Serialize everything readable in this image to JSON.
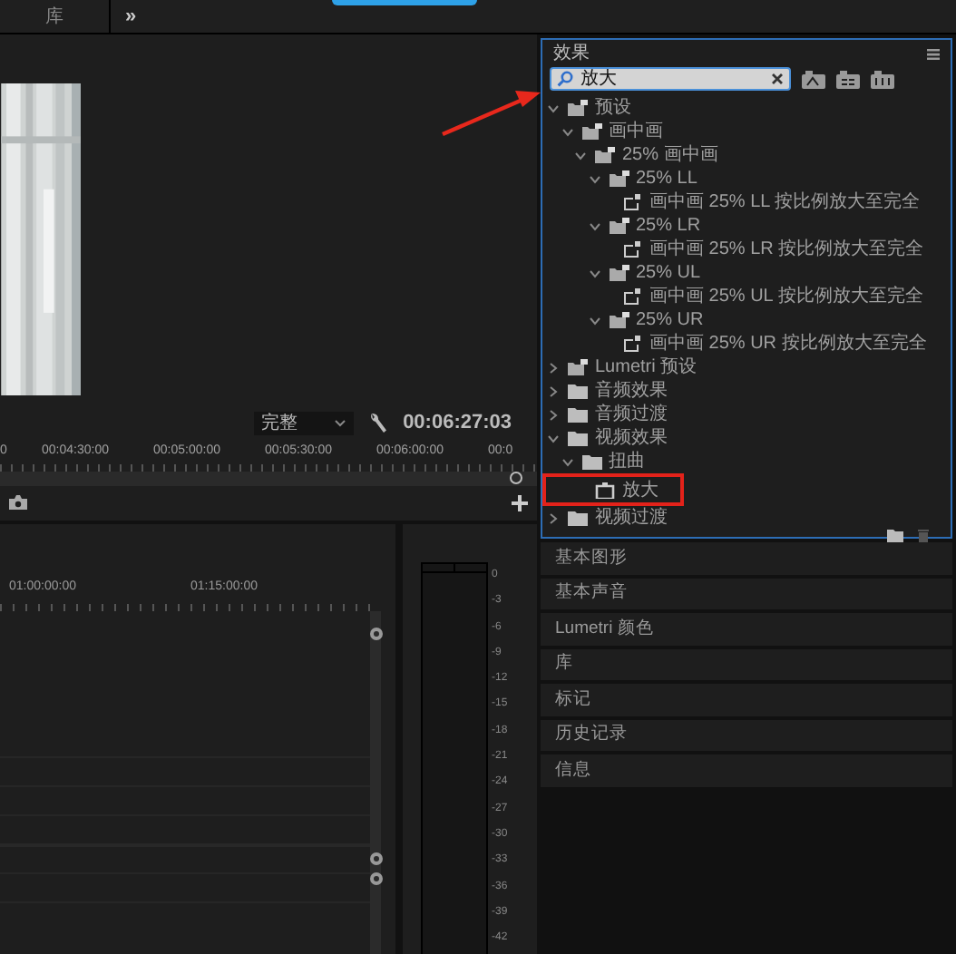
{
  "top_bar": {
    "tabs": [
      {
        "label": "库",
        "selected": false
      }
    ],
    "more": "»"
  },
  "monitor": {
    "quality": "完整",
    "timecode": "00:06:27:03",
    "ruler": [
      "0",
      "00:04:30:00",
      "00:05:00:00",
      "00:05:30:00",
      "00:06:00:00",
      "00:0"
    ]
  },
  "timeline": {
    "ruler": [
      "01:00:00:00",
      "01:15:00:00"
    ]
  },
  "meter": {
    "scale": [
      "0",
      "-3",
      "-6",
      "-9",
      "-12",
      "-15",
      "-18",
      "-21",
      "-24",
      "-27",
      "-30",
      "-33",
      "-36",
      "-39",
      "-42"
    ]
  },
  "effects_panel": {
    "title": "效果",
    "search": {
      "value": "放大"
    },
    "tree": [
      {
        "label": "预设",
        "kind": "bin",
        "expanded": true,
        "children": [
          {
            "label": "画中画",
            "kind": "bin",
            "expanded": true,
            "children": [
              {
                "label": "25% 画中画",
                "kind": "bin",
                "expanded": true,
                "children": [
                  {
                    "label": "25% LL",
                    "kind": "bin",
                    "expanded": true,
                    "children": [
                      {
                        "label": "画中画 25% LL 按比例放大至完全",
                        "kind": "preset"
                      }
                    ]
                  },
                  {
                    "label": "25% LR",
                    "kind": "bin",
                    "expanded": true,
                    "children": [
                      {
                        "label": "画中画 25% LR 按比例放大至完全",
                        "kind": "preset"
                      }
                    ]
                  },
                  {
                    "label": "25% UL",
                    "kind": "bin",
                    "expanded": true,
                    "children": [
                      {
                        "label": "画中画 25% UL 按比例放大至完全",
                        "kind": "preset"
                      }
                    ]
                  },
                  {
                    "label": "25% UR",
                    "kind": "bin",
                    "expanded": true,
                    "children": [
                      {
                        "label": "画中画 25% UR 按比例放大至完全",
                        "kind": "preset"
                      }
                    ]
                  }
                ]
              }
            ]
          }
        ]
      },
      {
        "label": "Lumetri 预设",
        "kind": "bin",
        "expanded": false
      },
      {
        "label": "音频效果",
        "kind": "folder",
        "expanded": false
      },
      {
        "label": "音频过渡",
        "kind": "folder",
        "expanded": false
      },
      {
        "label": "视频效果",
        "kind": "folder",
        "expanded": true,
        "children": [
          {
            "label": "扭曲",
            "kind": "folder",
            "expanded": true,
            "children": [
              {
                "label": "放大",
                "kind": "effect",
                "highlighted": true
              }
            ]
          }
        ]
      },
      {
        "label": "视频过渡",
        "kind": "folder",
        "expanded": false
      }
    ]
  },
  "panels": [
    "基本图形",
    "基本声音",
    "Lumetri 颜色",
    "库",
    "标记",
    "历史记录",
    "信息"
  ]
}
